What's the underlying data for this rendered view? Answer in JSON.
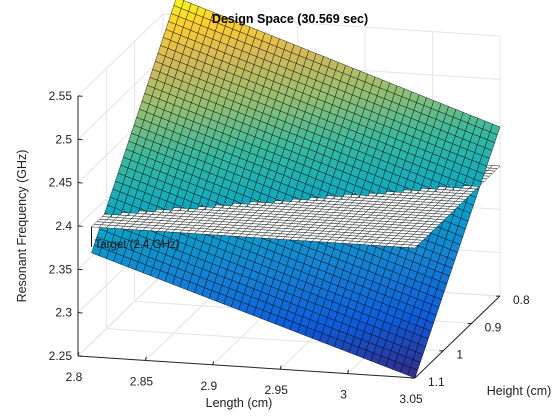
{
  "chart_data": {
    "type": "surface",
    "title": "Design Space (30.569 sec)",
    "xlabel": "Length (cm)",
    "ylabel": "Height (cm)",
    "zlabel": "Resonant Frequency (GHz)",
    "xlim": [
      2.8,
      3.05
    ],
    "ylim": [
      0.8,
      1.1
    ],
    "zlim": [
      2.25,
      2.55
    ],
    "x_ticks": [
      2.8,
      2.85,
      2.9,
      2.95,
      3.0,
      3.05
    ],
    "x_tick_labels": [
      "2.8",
      "2.85",
      "2.9",
      "2.95",
      "3",
      "3.05"
    ],
    "y_ticks": [
      0.8,
      0.9,
      1.0,
      1.1
    ],
    "y_tick_labels": [
      "0.8",
      "0.9",
      "1",
      "1.1"
    ],
    "z_ticks": [
      2.25,
      2.3,
      2.35,
      2.4,
      2.45,
      2.5,
      2.55
    ],
    "z_tick_labels": [
      "2.25",
      "2.3",
      "2.35",
      "2.4",
      "2.45",
      "2.5",
      "2.55"
    ],
    "grid": true,
    "colormap": "parula",
    "series": [
      {
        "surface": "frequency",
        "x_range": [
          2.81,
          3.05
        ],
        "y_range": [
          0.8,
          1.1
        ],
        "x_steps": 44,
        "y_steps": 32,
        "corners": {
          "x_min_y_min": 2.57,
          "x_max_y_min": 2.445,
          "x_min_y_max": 2.37,
          "x_max_y_max": 2.25
        }
      },
      {
        "surface": "target",
        "label": "Target (2.4 GHz)",
        "z": 2.4,
        "x_range": [
          2.81,
          3.05
        ],
        "y_range": [
          0.8,
          1.1
        ],
        "x_steps": 44,
        "y_steps": 32
      }
    ],
    "annotations": [
      {
        "text": "Target (2.4 GHz)",
        "x": 2.81,
        "y": 1.1,
        "z": 2.4
      }
    ]
  }
}
